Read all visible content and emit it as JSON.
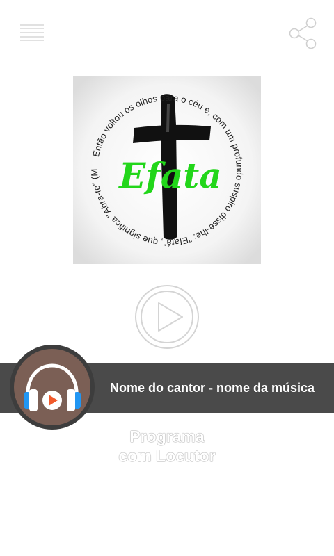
{
  "header": {
    "menu_icon": "hamburger-menu-icon",
    "share_icon": "share-icon"
  },
  "logo": {
    "brand_text": "Efata",
    "circle_text": "Então voltou os olhos para o céu e, com um profundo suspiro disse-lhe: \"Efatá\", que significa \"Abra-te\" (MC 7:34)",
    "brand_color": "#22d61a"
  },
  "player": {
    "play_icon": "play-circle-icon",
    "now_playing": "Nome do cantor - nome da música",
    "artwork_icon": "headphones-play-icon",
    "program_line1": "Programa",
    "program_line2": "com Locutor"
  },
  "colors": {
    "bar": "#4a4a4a",
    "avatar_bg": "#7b5f55",
    "headphone_blue": "#2196f3",
    "play_red": "#f15a2b"
  }
}
